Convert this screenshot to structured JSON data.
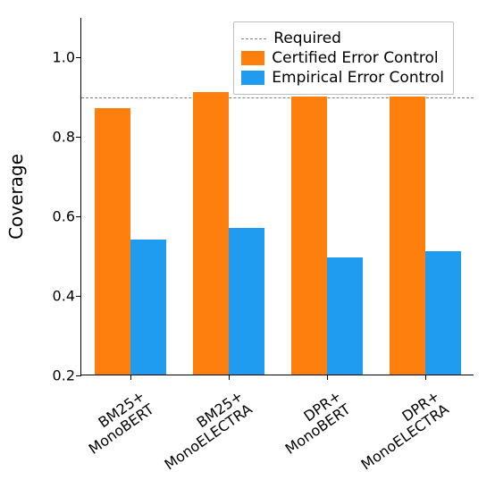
{
  "chart_data": {
    "type": "bar",
    "ylabel": "Coverage",
    "xlabel": "",
    "ylim": [
      0.2,
      1.1
    ],
    "yticks": [
      0.2,
      0.4,
      0.6,
      0.8,
      1.0
    ],
    "required_level": 0.9,
    "categories": [
      "BM25+\nMonoBERT",
      "BM25+\nMonoELECTRA",
      "DPR+\nMonoBERT",
      "DPR+\nMonoELECTRA"
    ],
    "series": [
      {
        "name": "Certified Error Control",
        "color": "#ff7f0e",
        "values": [
          0.87,
          0.91,
          0.9,
          0.9
        ]
      },
      {
        "name": "Empirical Error Control",
        "color": "#1f9cf0",
        "values": [
          0.54,
          0.57,
          0.495,
          0.51
        ]
      }
    ],
    "legend": {
      "required_label": "Required",
      "certified_label": "Certified Error Control",
      "empirical_label": "Empirical Error Control"
    }
  }
}
